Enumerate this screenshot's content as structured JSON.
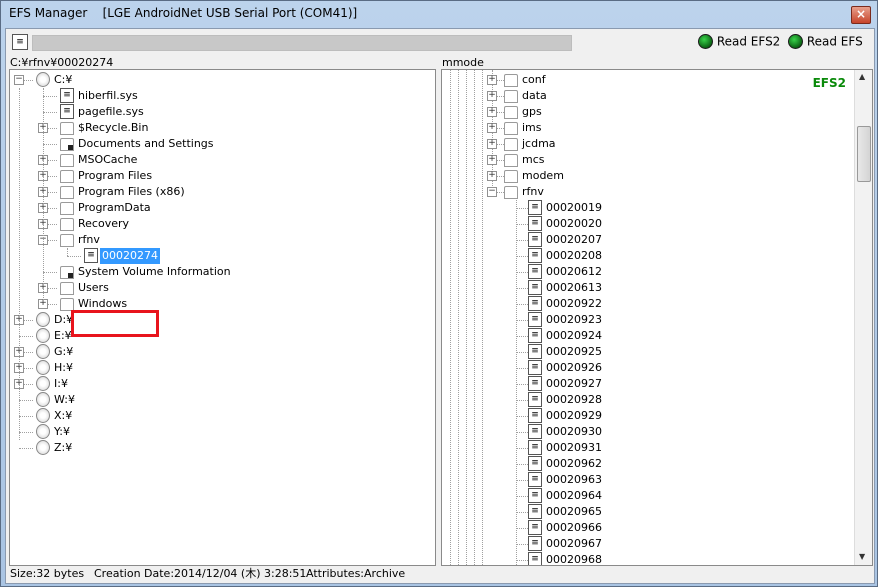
{
  "window": {
    "title": "EFS Manager    [LGE AndroidNet USB Serial Port (COM41)]",
    "close_label": "×"
  },
  "toolbar": {
    "read_efs2_label": "Read EFS2",
    "read_efs_label": "Read EFS",
    "led_color": "#1fae2b"
  },
  "left": {
    "path": "C:¥rfnv¥00020274",
    "tree": [
      {
        "label": "C:¥",
        "type": "drive",
        "level": 0,
        "expander": "-"
      },
      {
        "label": "hiberfil.sys",
        "type": "file",
        "level": 1,
        "expander": ""
      },
      {
        "label": "pagefile.sys",
        "type": "file",
        "level": 1,
        "expander": ""
      },
      {
        "label": "$Recycle.Bin",
        "type": "folder",
        "level": 1,
        "expander": "+"
      },
      {
        "label": "Documents and Settings",
        "type": "folder-lock",
        "level": 1,
        "expander": ""
      },
      {
        "label": "MSOCache",
        "type": "folder",
        "level": 1,
        "expander": "+"
      },
      {
        "label": "Program Files",
        "type": "folder",
        "level": 1,
        "expander": "+"
      },
      {
        "label": "Program Files (x86)",
        "type": "folder",
        "level": 1,
        "expander": "+"
      },
      {
        "label": "ProgramData",
        "type": "folder",
        "level": 1,
        "expander": "+"
      },
      {
        "label": "Recovery",
        "type": "folder",
        "level": 1,
        "expander": "+"
      },
      {
        "label": "rfnv",
        "type": "folder",
        "level": 1,
        "expander": "-"
      },
      {
        "label": "00020274",
        "type": "file",
        "level": 2,
        "expander": "",
        "selected": true
      },
      {
        "label": "System Volume Information",
        "type": "folder-lock",
        "level": 1,
        "expander": ""
      },
      {
        "label": "Users",
        "type": "folder",
        "level": 1,
        "expander": "+"
      },
      {
        "label": "Windows",
        "type": "folder",
        "level": 1,
        "expander": "+"
      },
      {
        "label": "D:¥",
        "type": "drive",
        "level": 0,
        "expander": "+"
      },
      {
        "label": "E:¥",
        "type": "drive",
        "level": 0,
        "expander": ""
      },
      {
        "label": "G:¥",
        "type": "drive",
        "level": 0,
        "expander": "+"
      },
      {
        "label": "H:¥",
        "type": "drive",
        "level": 0,
        "expander": "+"
      },
      {
        "label": "I:¥",
        "type": "drive",
        "level": 0,
        "expander": "+"
      },
      {
        "label": "W:¥",
        "type": "drive",
        "level": 0,
        "expander": ""
      },
      {
        "label": "X:¥",
        "type": "drive",
        "level": 0,
        "expander": ""
      },
      {
        "label": "Y:¥",
        "type": "drive",
        "level": 0,
        "expander": ""
      },
      {
        "label": "Z:¥",
        "type": "drive",
        "level": 0,
        "expander": ""
      }
    ]
  },
  "right": {
    "path": "mmode",
    "badge": "EFS2",
    "badge_color": "#0a8a0a",
    "tree": [
      {
        "label": "conf",
        "type": "folder",
        "expander": "+"
      },
      {
        "label": "data",
        "type": "folder",
        "expander": "+"
      },
      {
        "label": "gps",
        "type": "folder",
        "expander": "+"
      },
      {
        "label": "ims",
        "type": "folder",
        "expander": "+"
      },
      {
        "label": "jcdma",
        "type": "folder",
        "expander": "+"
      },
      {
        "label": "mcs",
        "type": "folder",
        "expander": "+"
      },
      {
        "label": "modem",
        "type": "folder",
        "expander": "+"
      },
      {
        "label": "rfnv",
        "type": "folder",
        "expander": "-"
      },
      {
        "label": "00020019",
        "type": "file"
      },
      {
        "label": "00020020",
        "type": "file"
      },
      {
        "label": "00020207",
        "type": "file"
      },
      {
        "label": "00020208",
        "type": "file"
      },
      {
        "label": "00020612",
        "type": "file"
      },
      {
        "label": "00020613",
        "type": "file"
      },
      {
        "label": "00020922",
        "type": "file"
      },
      {
        "label": "00020923",
        "type": "file"
      },
      {
        "label": "00020924",
        "type": "file"
      },
      {
        "label": "00020925",
        "type": "file"
      },
      {
        "label": "00020926",
        "type": "file"
      },
      {
        "label": "00020927",
        "type": "file"
      },
      {
        "label": "00020928",
        "type": "file"
      },
      {
        "label": "00020929",
        "type": "file"
      },
      {
        "label": "00020930",
        "type": "file"
      },
      {
        "label": "00020931",
        "type": "file"
      },
      {
        "label": "00020962",
        "type": "file"
      },
      {
        "label": "00020963",
        "type": "file"
      },
      {
        "label": "00020964",
        "type": "file"
      },
      {
        "label": "00020965",
        "type": "file"
      },
      {
        "label": "00020966",
        "type": "file"
      },
      {
        "label": "00020967",
        "type": "file"
      },
      {
        "label": "00020968",
        "type": "file"
      }
    ]
  },
  "status": {
    "size": "Size:32 bytes",
    "creation": "Creation Date:2014/12/04 (木) 3:28:51",
    "attributes": "Attributes:Archive"
  },
  "highlight_color": "#e8141c"
}
